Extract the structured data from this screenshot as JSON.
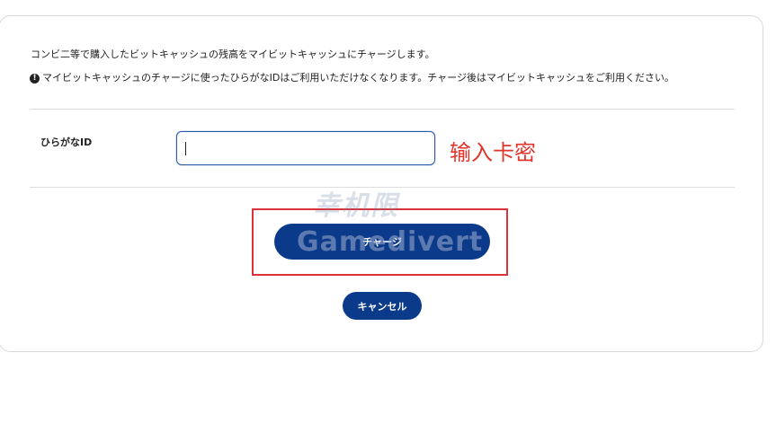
{
  "notice": {
    "description": "コンビ二等で購入したビットキャッシュの残高をマイビットキャッシュにチャージします。",
    "warning_icon": "exclamation-circle-icon",
    "warning": "マイビットキャッシュのチャージに使ったひらがなIDはご利用いただけなくなります。チャージ後はマイビットキャッシュをご利用ください。"
  },
  "form": {
    "id_label": "ひらがなID",
    "id_value": "",
    "id_placeholder": ""
  },
  "annotation": {
    "hint": "输入卡密",
    "color": "#e0352b"
  },
  "buttons": {
    "charge_label": "チャージ",
    "cancel_label": "キャンセル",
    "color": "#0b3a8a"
  },
  "watermark": {
    "logo_glyphs": "幸机限",
    "text": "Gamedivert"
  }
}
